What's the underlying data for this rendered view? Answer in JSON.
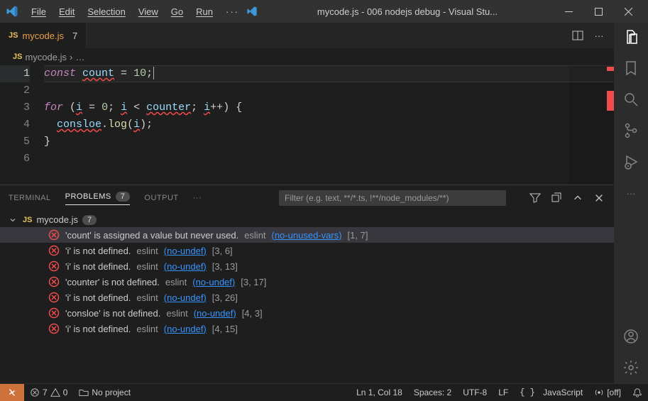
{
  "window": {
    "title": "mycode.js - 006 nodejs debug - Visual Stu..."
  },
  "menu": {
    "file": "File",
    "edit": "Edit",
    "selection": "Selection",
    "view": "View",
    "go": "Go",
    "run": "Run"
  },
  "tab": {
    "icon": "JS",
    "label": "mycode.js",
    "badge": "7"
  },
  "breadcrumb": {
    "icon": "JS",
    "file": "mycode.js"
  },
  "code": {
    "lines": {
      "1": {
        "kw": "const",
        "var": "count",
        "eq": " = ",
        "num": "10",
        "tail": ";"
      },
      "3": {
        "kw": "for",
        "open": " (",
        "v1": "i",
        "eq": " = ",
        "n0": "0",
        "sep1": "; ",
        "v2": "i",
        "lt": " < ",
        "v3": "counter",
        "sep2": "; ",
        "v4": "i",
        "inc": "++",
        "close": ") {"
      },
      "4": {
        "obj": "consloe",
        "dot": ".",
        "fn": "log",
        "open": "(",
        "arg": "i",
        "close": ");"
      },
      "5": "}"
    }
  },
  "panel": {
    "tabs": {
      "terminal": "TERMINAL",
      "problems": "PROBLEMS",
      "output": "OUTPUT"
    },
    "problems_badge": "7",
    "filter_placeholder": "Filter (e.g. text, **/*.ts, !**/node_modules/**)"
  },
  "problems_file": {
    "icon": "JS",
    "name": "mycode.js",
    "count": "7"
  },
  "problems": [
    {
      "msg": "'count' is assigned a value but never used.",
      "src": "eslint",
      "rule": "(no-unused-vars)",
      "loc": "[1, 7]"
    },
    {
      "msg": "'i' is not defined.",
      "src": "eslint",
      "rule": "(no-undef)",
      "loc": "[3, 6]"
    },
    {
      "msg": "'i' is not defined.",
      "src": "eslint",
      "rule": "(no-undef)",
      "loc": "[3, 13]"
    },
    {
      "msg": "'counter' is not defined.",
      "src": "eslint",
      "rule": "(no-undef)",
      "loc": "[3, 17]"
    },
    {
      "msg": "'i' is not defined.",
      "src": "eslint",
      "rule": "(no-undef)",
      "loc": "[3, 26]"
    },
    {
      "msg": "'consloe' is not defined.",
      "src": "eslint",
      "rule": "(no-undef)",
      "loc": "[4, 3]"
    },
    {
      "msg": "'i' is not defined.",
      "src": "eslint",
      "rule": "(no-undef)",
      "loc": "[4, 15]"
    }
  ],
  "status": {
    "errors": "7",
    "warnings": "0",
    "project": "No project",
    "position": "Ln 1, Col 18",
    "spaces": "Spaces: 2",
    "encoding": "UTF-8",
    "eol": "LF",
    "language": "JavaScript",
    "preview": "[off]"
  }
}
